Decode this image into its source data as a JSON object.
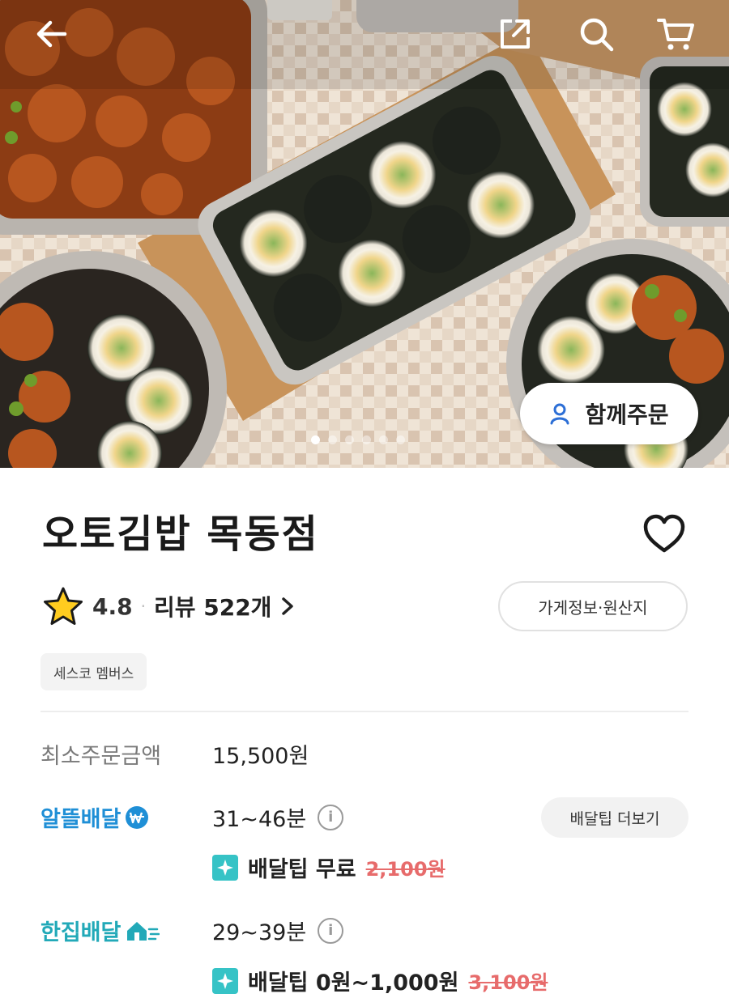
{
  "store": {
    "name": "오토김밥 목동점",
    "rating": "4.8",
    "review_text": "리뷰 522개",
    "info_button": "가게정보·원산지",
    "badge": "세스코 멤버스"
  },
  "hero": {
    "group_order_label": "함께주문",
    "carousel": {
      "total": 6,
      "current": 1
    }
  },
  "details": {
    "min_order": {
      "label": "최소주문금액",
      "value": "15,500원"
    },
    "saver_delivery": {
      "label": "알뜰배달",
      "time": "31~46분",
      "tip_label": "배달팁 무료",
      "original_tip": "2,100원"
    },
    "one_delivery": {
      "label": "한집배달",
      "time": "29~39분",
      "tip_label": "배달팁 0원~1,000원",
      "original_tip": "3,100원"
    },
    "more_tip_button": "배달팁 더보기"
  },
  "icons": {
    "back": "arrow-left-icon",
    "share": "share-icon",
    "search": "search-icon",
    "cart": "cart-icon",
    "favorite": "heart-icon",
    "star": "star-icon",
    "info": "info-icon",
    "spark": "sparkle-icon"
  },
  "colors": {
    "saver_blue": "#1f8fd6",
    "onedelivery_teal": "#22a9b8",
    "spark_teal": "#36c3c6",
    "strike_red": "#e76b6b",
    "group_order_icon": "#2d6fd6"
  }
}
